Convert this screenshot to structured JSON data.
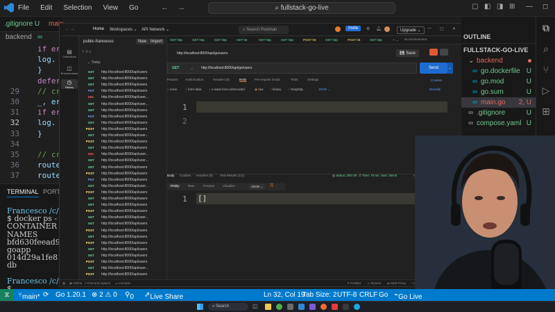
{
  "vscode": {
    "menu": [
      "File",
      "Edit",
      "Selection",
      "View",
      "Go"
    ],
    "search": "fullstack-go-live",
    "editor_tabs": [
      ".gitignore U",
      "backend",
      "main"
    ],
    "lines": [
      {
        "n": "",
        "code": "if err"
      },
      {
        "n": "",
        "code": "  log."
      },
      {
        "n": "",
        "code": "}"
      },
      {
        "n": "",
        "code": "defer"
      },
      {
        "n": "29",
        "code": "// cre"
      },
      {
        "n": "30",
        "code": "_, err"
      },
      {
        "n": "31",
        "code": "if err"
      },
      {
        "n": "32",
        "code": "  log."
      },
      {
        "n": "33",
        "code": "}"
      },
      {
        "n": "34",
        "code": ""
      },
      {
        "n": "35",
        "code": "// cre"
      },
      {
        "n": "36",
        "code": "router"
      },
      {
        "n": "37",
        "code": "router"
      },
      {
        "n": "38",
        "code": "router"
      },
      {
        "n": "39",
        "code": "router"
      }
    ],
    "terminal_tabs": [
      "TERMINAL",
      "PORTS"
    ],
    "terminal_lines": [
      "Francesco /c/",
      "$ docker ps -",
      "CONTAINER ID",
      " NAMES",
      "bfd630feead9",
      " goapp",
      "014d29a1fe81",
      " db",
      "",
      "Francesco /c/",
      "$"
    ],
    "explorer": {
      "header": "OUTLINE",
      "project": "FULLSTACK-GO-LIVE",
      "items": [
        {
          "label": "backend",
          "badge": "",
          "color": "#e06c5e"
        },
        {
          "label": "go.dockerfile",
          "badge": "U",
          "color": "#73c991"
        },
        {
          "label": "go.mod",
          "badge": "U",
          "color": "#73c991"
        },
        {
          "label": "go.sum",
          "badge": "U",
          "color": "#73c991"
        },
        {
          "label": "main.go",
          "badge": "2, U",
          "color": "#e06c5e"
        },
        {
          "label": ".gitignore",
          "badge": "U",
          "color": "#73c991"
        },
        {
          "label": "compose.yaml",
          "badge": "U",
          "color": "#73c991"
        }
      ]
    },
    "status": {
      "branch": "main*",
      "go": "Go 1.20.1",
      "problems": "⊗ 2 ⚠ 0",
      "ports": "0",
      "liveshare": "Live Share",
      "position": "Ln 32, Col 19",
      "tab": "Tab Size: 2",
      "enc": "UTF-8",
      "eol": "CRLF",
      "lang": "Go",
      "golive": "Go Live"
    },
    "taskbar_search": "Search"
  },
  "postman": {
    "nav": [
      "Home",
      "Workspaces ⌄",
      "API Network ⌄"
    ],
    "search": "Search Postman",
    "invite": "Invite",
    "upgrade": "Upgrade ⌄",
    "workspace": "public-francesco",
    "new": "New",
    "import": "Import",
    "sidebar": [
      "Collections",
      "Environments",
      "History"
    ],
    "today": "Today",
    "history": [
      {
        "m": "GET",
        "u": "http://localhost:8000/api/users"
      },
      {
        "m": "GET",
        "u": "http://localhost:8000/api/users"
      },
      {
        "m": "GET",
        "u": "http://localhost:8000/api/users"
      },
      {
        "m": "PUT",
        "u": "http://localhost:8000/api/users"
      },
      {
        "m": "DEL",
        "u": "http://localhost:8000/api/user..."
      },
      {
        "m": "GET",
        "u": "http://localhost:8000/api/user..."
      },
      {
        "m": "GET",
        "u": "http://localhost:8000/api/users"
      },
      {
        "m": "PUT",
        "u": "http://localhost:8000/api/users"
      },
      {
        "m": "GET",
        "u": "http://localhost:8000/api/users"
      },
      {
        "m": "POST",
        "u": "http://localhost:8000/api/users"
      },
      {
        "m": "GET",
        "u": "http://localhost:8000/api/user..."
      },
      {
        "m": "POST",
        "u": "http://localhost:8000/api/users"
      },
      {
        "m": "GET",
        "u": "http://localhost:8000/api/users"
      },
      {
        "m": "DEL",
        "u": "http://localhost:8000/api/user..."
      },
      {
        "m": "GET",
        "u": "http://localhost:8000/api/user..."
      },
      {
        "m": "GET",
        "u": "http://localhost:8000/api/users"
      },
      {
        "m": "POST",
        "u": "http://localhost:8000/api/users"
      },
      {
        "m": "PUT",
        "u": "http://localhost:8000/api/users"
      },
      {
        "m": "GET",
        "u": "http://localhost:8000/api/user..."
      },
      {
        "m": "POST",
        "u": "http://localhost:8000/api/users"
      },
      {
        "m": "GET",
        "u": "http://localhost:8000/api/users"
      },
      {
        "m": "GET",
        "u": "http://localhost:8000/api/users"
      },
      {
        "m": "POST",
        "u": "http://localhost:8000/api/users"
      },
      {
        "m": "GET",
        "u": "http://localhost:8000/api/user..."
      },
      {
        "m": "GET",
        "u": "http://localhost:8000/api/users"
      },
      {
        "m": "POST",
        "u": "http://localhost:8000/api/users"
      },
      {
        "m": "GET",
        "u": "http://localhost:8000/api/users"
      },
      {
        "m": "POST",
        "u": "http://localhost:8000/api/users"
      },
      {
        "m": "GET",
        "u": "http://localhost:8000/api/users"
      },
      {
        "m": "GET",
        "u": "http://localhost:8000/api/users"
      },
      {
        "m": "POST",
        "u": "http://localhost:8000/api/users"
      },
      {
        "m": "GET",
        "u": "http://localhost:8000/api/user..."
      },
      {
        "m": "POST",
        "u": "http://localhost:8000/api/users"
      }
    ],
    "tabs": [
      "GET http",
      "GET http",
      "GET http",
      "GET htt",
      "GET http",
      "GET http",
      "POST htt",
      "GET http",
      "POST htt",
      "GET http"
    ],
    "environment": "No Environment",
    "request_title": "http://localhost:8000/api/go/users",
    "save": "Save",
    "method": "GET",
    "url": "http://localhost:8000/api/go/users",
    "send": "Send",
    "req_tabs": [
      "Params",
      "Authorization",
      "Headers (9)",
      "Body",
      "Pre-request Script",
      "Tests",
      "Settings"
    ],
    "cookies": "Cookies",
    "body_types": [
      "none",
      "form-data",
      "x-www-form-urlencoded",
      "raw",
      "binary",
      "GraphQL"
    ],
    "body_format": "JSON ⌄",
    "beautify": "Beautify",
    "body_lines": [
      "1",
      "2"
    ],
    "resp_tabs": [
      "Body",
      "Cookies",
      "Headers (6)",
      "Test Results (1/1)"
    ],
    "resp_status": "Status: 200 OK",
    "resp_time": "Time: 70 ms",
    "resp_size": "Size: 349 B",
    "save_example": "Save as example",
    "view_tabs": [
      "Pretty",
      "Raw",
      "Preview",
      "Visualize"
    ],
    "view_format": "JSON ⌄",
    "resp_line": "1",
    "resp_body": "[]",
    "footer_left": [
      "Online",
      "Find and replace",
      "Console"
    ],
    "footer_right": [
      "Postbot",
      "Runner",
      "Start Proxy",
      "Cook"
    ]
  }
}
